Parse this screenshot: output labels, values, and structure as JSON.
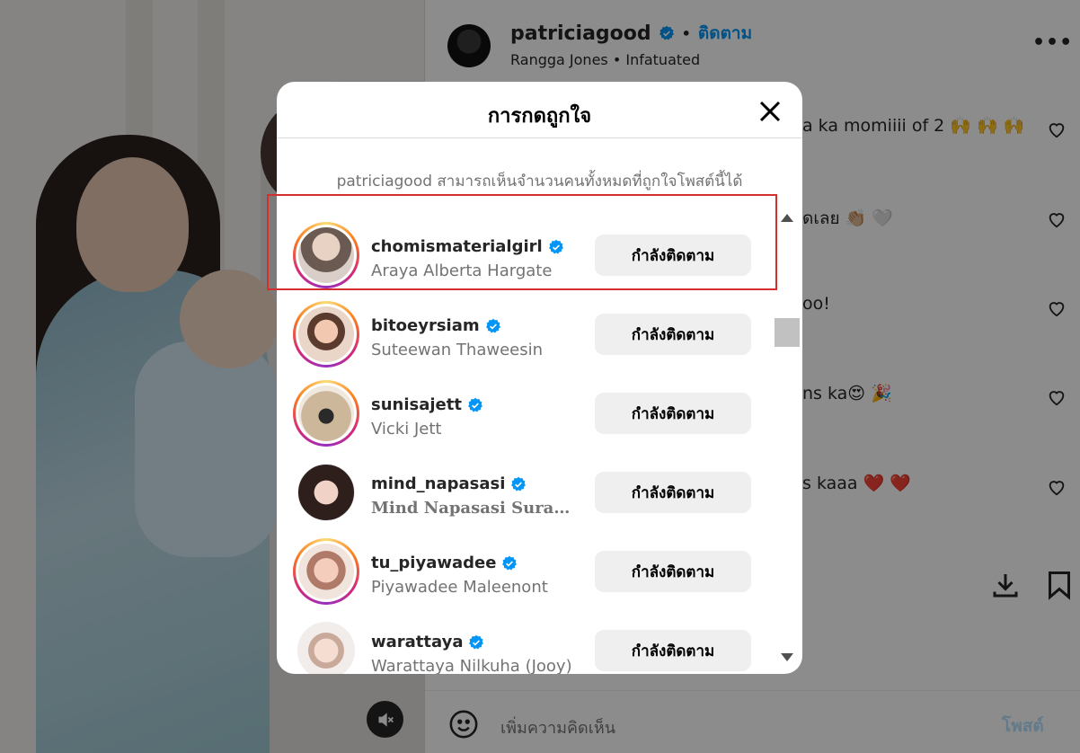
{
  "post_header": {
    "username": "patriciagood",
    "follow_label": "ติดตาม",
    "dot": "•",
    "subtitle": "Rangga Jones • Infatuated",
    "more": "•••"
  },
  "comments_visible": [
    {
      "text": "a ka momiiii of 2 🙌 🙌 🙌"
    },
    {
      "text": "ดเลย 👏🏼 🤍"
    },
    {
      "text": "oo!"
    },
    {
      "text": "ns ka😍 🎉"
    },
    {
      "text": "s kaaa ❤️ ❤️"
    }
  ],
  "comment_box": {
    "placeholder": "เพิ่มความคิดเห็น",
    "post_label": "โพสต์"
  },
  "likes_modal": {
    "title": "การกดถูกใจ",
    "note": "patriciagood สามารถเห็นจำนวนคนทั้งหมดที่ถูกใจโพสต์นี้ได้",
    "users": [
      {
        "username": "chomismaterialgirl",
        "full_name": "Araya Alberta Hargate",
        "button": "กำลังติดตาม",
        "has_story": true,
        "avatar_color": "#6b5a52"
      },
      {
        "username": "bitoeyrsiam",
        "full_name": "Suteewan Thaweesin",
        "button": "กำลังติดตาม",
        "has_story": true,
        "avatar_color": "#d9a88c"
      },
      {
        "username": "sunisajett",
        "full_name": "Vicki Jett",
        "button": "กำลังติดตาม",
        "has_story": true,
        "avatar_color": "#b89c7a"
      },
      {
        "username": "mind_napasasi",
        "full_name": "Mind Napasasi Suraw…",
        "button": "กำลังติดตาม",
        "has_story": false,
        "avatar_color": "#3a2a28"
      },
      {
        "username": "tu_piyawadee",
        "full_name": "Piyawadee Maleenont",
        "button": "กำลังติดตาม",
        "has_story": true,
        "avatar_color": "#e0a8a0"
      },
      {
        "username": "warattaya",
        "full_name": "Warattaya Nilkuha (Jooy)",
        "button": "กำลังติดตาม",
        "has_story": false,
        "avatar_color": "#e8dcd6"
      }
    ]
  },
  "colors": {
    "accent": "#0095f6",
    "verified": "#0095f6",
    "highlight": "#d32f2f"
  }
}
